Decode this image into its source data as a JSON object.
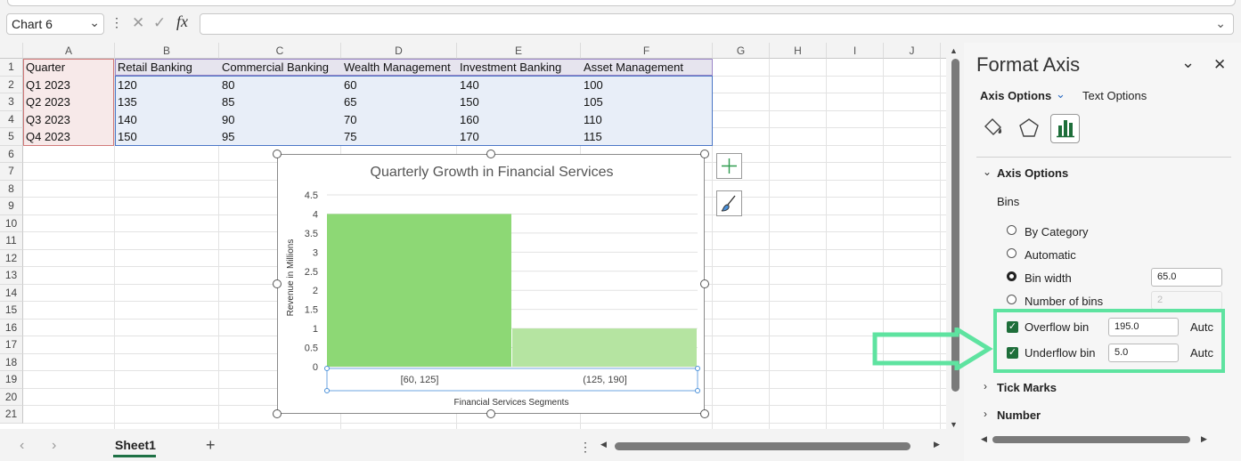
{
  "formula_bar": {
    "name_box": "Chart 6",
    "fx": "fx",
    "cancel_glyph": "✕",
    "enter_glyph": "✓",
    "more_glyph": "⋮"
  },
  "columns": [
    "A",
    "B",
    "C",
    "D",
    "E",
    "F",
    "G",
    "H",
    "I",
    "J"
  ],
  "rows": [
    "1",
    "2",
    "3",
    "4",
    "5",
    "6",
    "7",
    "8",
    "9",
    "10",
    "11",
    "12",
    "13",
    "14",
    "15",
    "16",
    "17",
    "18",
    "19",
    "20",
    "21"
  ],
  "table": {
    "headers": [
      "Quarter",
      "Retail Banking",
      "Commercial Banking",
      "Wealth Management",
      "Investment Banking",
      "Asset Management"
    ],
    "data": [
      [
        "Q1 2023",
        "120",
        "80",
        "60",
        "140",
        "100"
      ],
      [
        "Q2 2023",
        "135",
        "85",
        "65",
        "150",
        "105"
      ],
      [
        "Q3 2023",
        "140",
        "90",
        "70",
        "160",
        "110"
      ],
      [
        "Q4 2023",
        "150",
        "95",
        "75",
        "170",
        "115"
      ]
    ]
  },
  "chart_data": {
    "type": "bar",
    "title": "Quarterly Growth in Financial Services",
    "xlabel": "Financial Services Segments",
    "ylabel": "Revenue in Millions",
    "categories": [
      "[60, 125]",
      "(125, 190]"
    ],
    "values": [
      4,
      1
    ],
    "ylim": [
      0,
      4.5
    ],
    "yticks": [
      "0",
      "0.5",
      "1",
      "1.5",
      "2",
      "2.5",
      "3",
      "3.5",
      "4",
      "4.5"
    ],
    "bar_colors": [
      "#8dd875",
      "#b5e4a1"
    ],
    "grid": true,
    "legend": "none"
  },
  "chart_buttons": {
    "add": "+",
    "style_icon": "brush-icon"
  },
  "sheet": {
    "tab": "Sheet1",
    "add": "+",
    "more": "⋮"
  },
  "pane": {
    "title": "Format Axis",
    "tab_axis": "Axis Options",
    "tab_text": "Text Options",
    "section_axis": "Axis Options",
    "bins_label": "Bins",
    "by_category": "By Category",
    "automatic": "Automatic",
    "bin_width": "Bin width",
    "bin_width_value": "65.0",
    "number_of_bins": "Number of bins",
    "number_of_bins_value": "2",
    "overflow_bin": "Overflow bin",
    "overflow_value": "195.0",
    "underflow_bin": "Underflow bin",
    "underflow_value": "5.0",
    "auto_1": "Autc",
    "auto_2": "Autc",
    "tick_marks": "Tick Marks",
    "number": "Number"
  },
  "colors": {
    "accent_green": "#1e7145",
    "highlight": "#5ee3a0"
  }
}
